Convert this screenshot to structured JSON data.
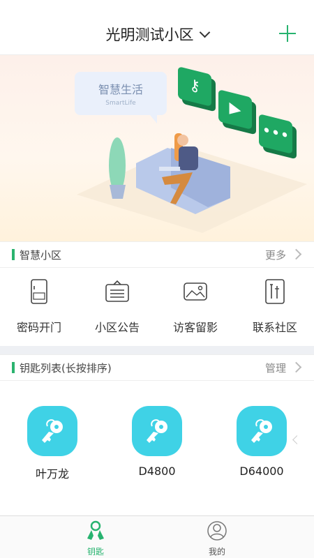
{
  "header": {
    "title": "光明测试小区",
    "add_icon": "plus-icon",
    "accent": "#27b36f"
  },
  "banner": {
    "bubble_title": "智慧生活",
    "bubble_subtitle": "SmartLife"
  },
  "smart_section": {
    "title": "智慧小区",
    "more_label": "更多",
    "features": [
      {
        "label": "密码开门",
        "icon": "password-door-icon"
      },
      {
        "label": "小区公告",
        "icon": "announcement-icon"
      },
      {
        "label": "访客留影",
        "icon": "visitor-photo-icon"
      },
      {
        "label": "联系社区",
        "icon": "contact-community-icon"
      }
    ]
  },
  "key_section": {
    "title": "钥匙列表(长按排序)",
    "manage_label": "管理",
    "keys": [
      {
        "name": "叶万龙"
      },
      {
        "name": "D4800"
      },
      {
        "name": "D64000"
      }
    ]
  },
  "tabs": [
    {
      "label": "钥匙",
      "icon": "key-tab-icon",
      "active": true
    },
    {
      "label": "我的",
      "icon": "user-tab-icon",
      "active": false
    }
  ]
}
